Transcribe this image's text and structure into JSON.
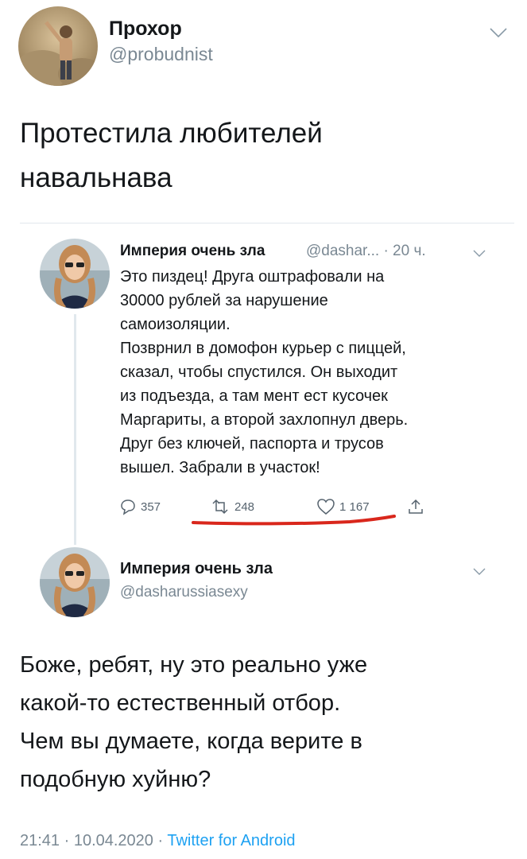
{
  "main_tweet": {
    "author_name": "Прохор",
    "author_handle": "@probudnist",
    "text_line1": "Протестила любителей",
    "text_line2": "навальнава"
  },
  "quoted_tweet": {
    "author_name": "Империя очень зла",
    "handle_time": "@dashar... · 20 ч.",
    "lines": [
      "Это пиздец! Друга оштрафовали на",
      "30000 рублей за нарушение",
      "самоизоляции.",
      "Позврнил в домофон курьер с пиццей,",
      "сказал, чтобы спустился. Он выходит",
      "из подъезда, а там мент ест кусочек",
      "Маргариты, а второй захлопнул дверь.",
      "Друг без ключей, паспорта и трусов",
      "вышел. Забрали в участок!"
    ],
    "replies": "357",
    "retweets": "248",
    "likes": "1 167"
  },
  "reply_tweet": {
    "author_name": "Империя очень зла",
    "author_handle": "@dasharussiasexy",
    "lines": [
      "Боже, ребят, ну это реально уже",
      "какой-то естественный отбор.",
      "Чем вы думаете, когда верите в",
      "подобную хуйню?"
    ],
    "timestamp": "21:41 · 10.04.2020 · ",
    "source": "Twitter for Android"
  },
  "colors": {
    "link": "#1da1f2",
    "underline": "#d9271c",
    "muted": "#7a8893"
  },
  "icons": [
    "chevron-down-icon",
    "reply-icon",
    "retweet-icon",
    "like-icon",
    "share-icon"
  ]
}
